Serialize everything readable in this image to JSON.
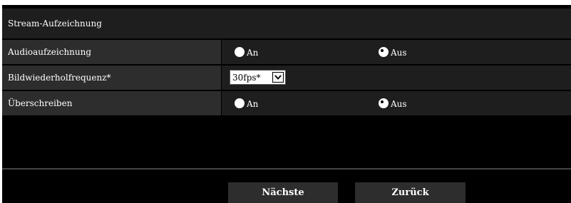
{
  "section": {
    "title": "Stream-Aufzeichnung"
  },
  "audio_recording": {
    "label": "Audioaufzeichnung",
    "options": [
      {
        "label": "An",
        "checked": false
      },
      {
        "label": "Aus",
        "checked": true
      }
    ]
  },
  "frame_rate": {
    "label": "Bildwiederholfrequenz*",
    "selected": "30fps*"
  },
  "overwrite": {
    "label": "Überschreiben",
    "options": [
      {
        "label": "An",
        "checked": false
      },
      {
        "label": "Aus",
        "checked": true
      }
    ]
  },
  "buttons": {
    "next": "Nächste",
    "back": "Zurück"
  },
  "colors": {
    "background": "#000000",
    "row_label": "#2d2d2d",
    "row_value": "#1e1e1e",
    "text": "#ffffff"
  }
}
